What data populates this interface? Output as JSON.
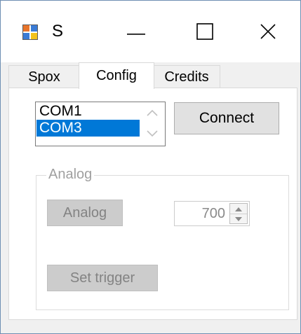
{
  "window": {
    "title": "S"
  },
  "tabs": [
    {
      "label": "Spox"
    },
    {
      "label": "Config"
    },
    {
      "label": "Credits"
    }
  ],
  "active_tab": "Config",
  "ports": {
    "items": [
      "COM1",
      "COM3"
    ],
    "selected": "COM3"
  },
  "connect": {
    "label": "Connect"
  },
  "analog_group": {
    "title": "Analog",
    "analog_button_label": "Analog",
    "numeric_value": "700",
    "set_trigger_label": "Set trigger"
  },
  "colors": {
    "selection": "#0078d7",
    "disabled_text": "#838383",
    "disabled_button": "#cccccc"
  },
  "icons": {
    "app": "app-window-icon",
    "minimize": "minimize-icon",
    "maximize": "maximize-icon",
    "close": "close-icon"
  }
}
